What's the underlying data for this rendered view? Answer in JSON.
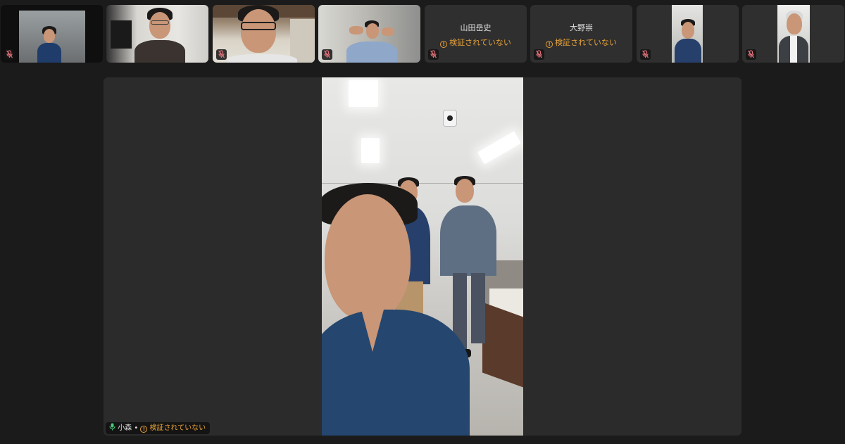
{
  "participants": [
    {
      "id": "p1",
      "name": "",
      "status": "",
      "muted": true,
      "video": true
    },
    {
      "id": "p2",
      "name": "",
      "status": "",
      "muted": false,
      "video": true
    },
    {
      "id": "p3",
      "name": "",
      "status": "",
      "muted": true,
      "video": true
    },
    {
      "id": "p4",
      "name": "",
      "status": "",
      "muted": true,
      "video": true
    },
    {
      "id": "p5",
      "name": "山田岳史",
      "status": "検証されていない",
      "muted": true,
      "video": false
    },
    {
      "id": "p6",
      "name": "大野崇",
      "status": "検証されていない",
      "muted": true,
      "video": false
    },
    {
      "id": "p7",
      "name": "",
      "status": "",
      "muted": true,
      "video": true
    },
    {
      "id": "p8",
      "name": "",
      "status": "",
      "muted": true,
      "video": true
    }
  ],
  "spotlight": {
    "name": "小森",
    "separator": "•",
    "status": "検証されていない",
    "mic_state": "active"
  },
  "colors": {
    "background": "#1b1b1b",
    "tile": "#2f2f2f",
    "warning": "#e8a23a",
    "mic_muted": "#e0707a",
    "mic_active": "#4cc77a"
  },
  "icons": {
    "muted": "mic-off-icon",
    "active": "mic-on-icon",
    "warning": "warning-circle-icon"
  }
}
